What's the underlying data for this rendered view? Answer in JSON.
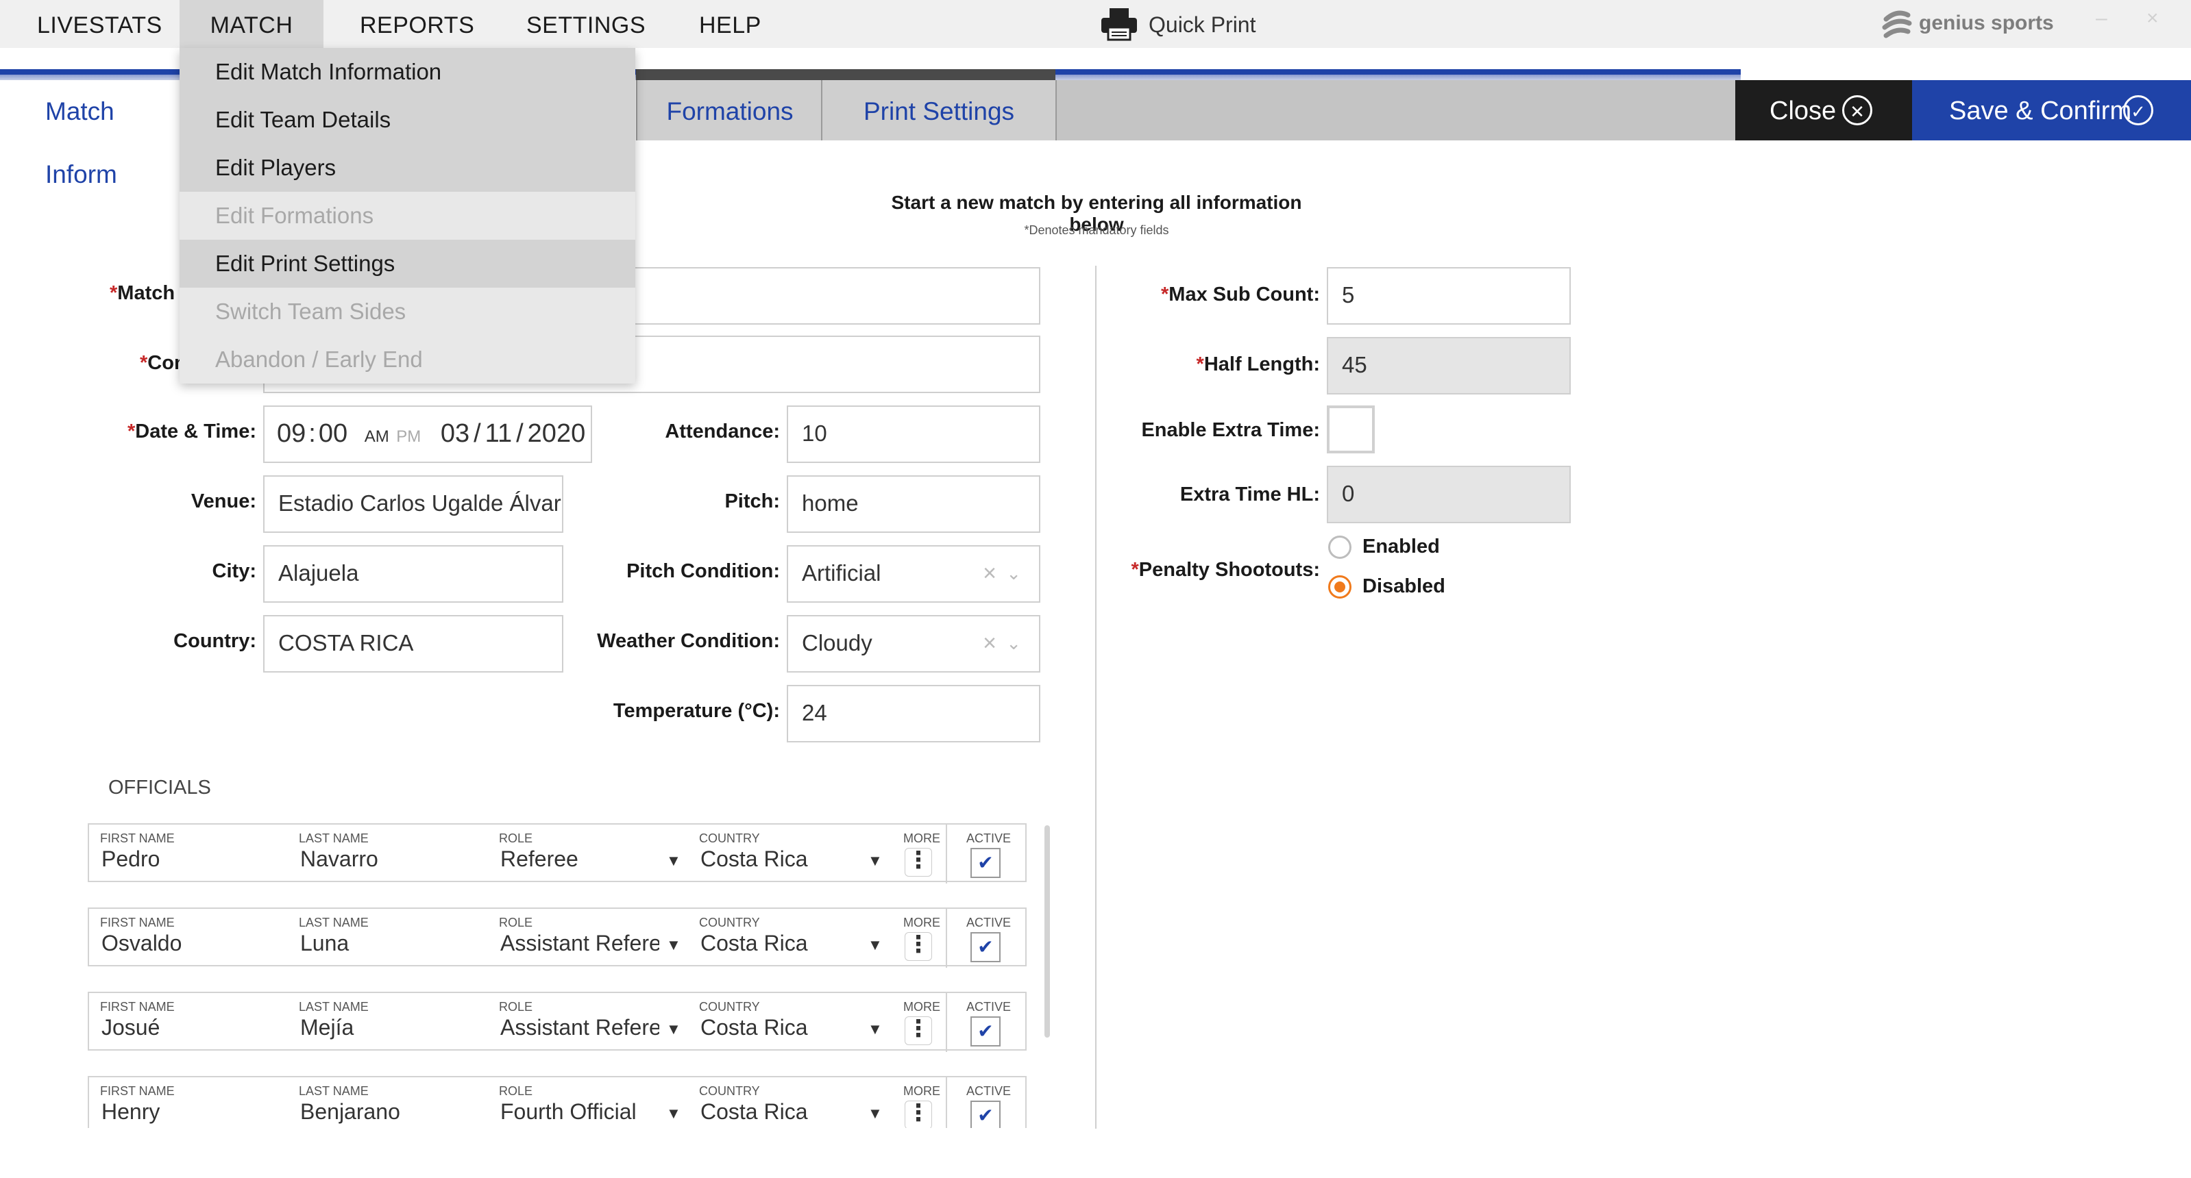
{
  "menubar": {
    "items": [
      "LIVESTATS",
      "MATCH",
      "REPORTS",
      "SETTINGS",
      "HELP"
    ],
    "quick_print": "Quick Print",
    "brand": "genius sports",
    "minimize": "–",
    "close": "×"
  },
  "match_menu": {
    "items": [
      {
        "label": "Edit Match Information",
        "enabled": true
      },
      {
        "label": "Edit Team Details",
        "enabled": true
      },
      {
        "label": "Edit Players",
        "enabled": true
      },
      {
        "label": "Edit Formations",
        "enabled": false
      },
      {
        "label": "Edit Print Settings",
        "enabled": true
      },
      {
        "label": "Switch Team Sides",
        "enabled": false
      },
      {
        "label": "Abandon / Early End",
        "enabled": false
      }
    ]
  },
  "tabs": {
    "match_info": "Match Inform",
    "formations": "Formations",
    "print_settings": "Print Settings",
    "close": "Close",
    "save_confirm": "Save & Confirm"
  },
  "intro": {
    "title": "Start a new match by entering all information below",
    "mandatory": "*Denotes mandatory fields"
  },
  "form": {
    "match_label": "Match",
    "comp_label": "Con",
    "date_time_label": "Date & Time:",
    "time_hour": "09",
    "time_sep": ":",
    "time_min": "00",
    "am": "AM",
    "pm": "PM",
    "date_month": "03",
    "date_day": "11",
    "date_year": "2020",
    "date_sep": "/",
    "venue_label": "Venue:",
    "venue": "Estadio Carlos Ugalde Álvarez",
    "city_label": "City:",
    "city": "Alajuela",
    "country_label": "Country:",
    "country": "COSTA RICA",
    "attendance_label": "Attendance:",
    "attendance": "10",
    "pitch_label": "Pitch:",
    "pitch": "home",
    "pitch_condition_label": "Pitch Condition:",
    "pitch_condition": "Artificial",
    "weather_label": "Weather Condition:",
    "weather": "Cloudy",
    "temperature_label": "Temperature (°C):",
    "temperature": "24",
    "max_sub_label": "Max Sub Count:",
    "max_sub": "5",
    "half_length_label": "Half Length:",
    "half_length": "45",
    "extra_time_label": "Enable Extra Time:",
    "extra_time_hl_label": "Extra Time HL:",
    "extra_time_hl": "0",
    "penalty_label": "Penalty Shootouts:",
    "penalty_enabled": "Enabled",
    "penalty_disabled": "Disabled",
    "req_star": "*",
    "clear": "×",
    "chevron": "⌄"
  },
  "officials": {
    "heading": "OFFICIALS",
    "col_first": "FIRST NAME",
    "col_last": "LAST NAME",
    "col_role": "ROLE",
    "col_country": "COUNTRY",
    "col_more": "MORE",
    "col_active": "ACTIVE",
    "more_glyph": "⋮",
    "check_glyph": "✔",
    "caret_glyph": "▼",
    "rows": [
      {
        "first": "Pedro",
        "last": "Navarro",
        "role": "Referee",
        "country": "Costa Rica"
      },
      {
        "first": "Osvaldo",
        "last": "Luna",
        "role": "Assistant Referee",
        "country": "Costa Rica"
      },
      {
        "first": "Josué",
        "last": "Mejía",
        "role": "Assistant Referee",
        "country": "Costa Rica"
      },
      {
        "first": "Henry",
        "last": "Benjarano",
        "role": "Fourth Official",
        "country": "Costa Rica"
      }
    ]
  },
  "colors": {
    "accent": "#1f43a8",
    "required": "#c62828",
    "radio_on": "#f07a1c"
  }
}
